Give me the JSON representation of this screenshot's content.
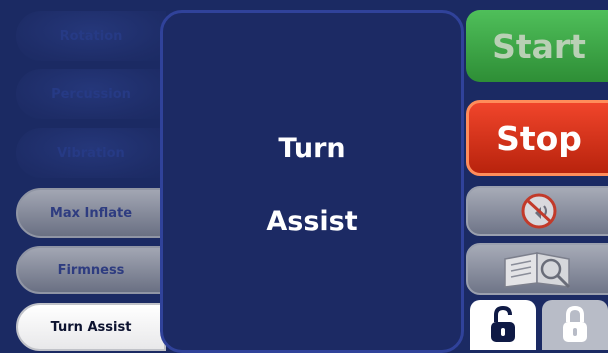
{
  "left_menu": {
    "items": [
      {
        "label": "Rotation",
        "state": "disabled"
      },
      {
        "label": "Percussion",
        "state": "disabled"
      },
      {
        "label": "Vibration",
        "state": "disabled"
      },
      {
        "label": "Max Inflate",
        "state": "inactive"
      },
      {
        "label": "Firmness",
        "state": "inactive"
      },
      {
        "label": "Turn Assist",
        "state": "active"
      }
    ]
  },
  "center_panel": {
    "line1": "Turn",
    "line2": "Assist"
  },
  "right_controls": {
    "start_label": "Start",
    "stop_label": "Stop",
    "mute_icon": "no-sound-icon",
    "manual_icon": "manual-search-icon",
    "unlock_icon": "unlocked-padlock-icon",
    "lock_icon": "locked-padlock-icon"
  },
  "colors": {
    "background": "#1b2a63",
    "start": "#3fa94a",
    "stop": "#e03a1f",
    "active_button": "#ffffff"
  }
}
